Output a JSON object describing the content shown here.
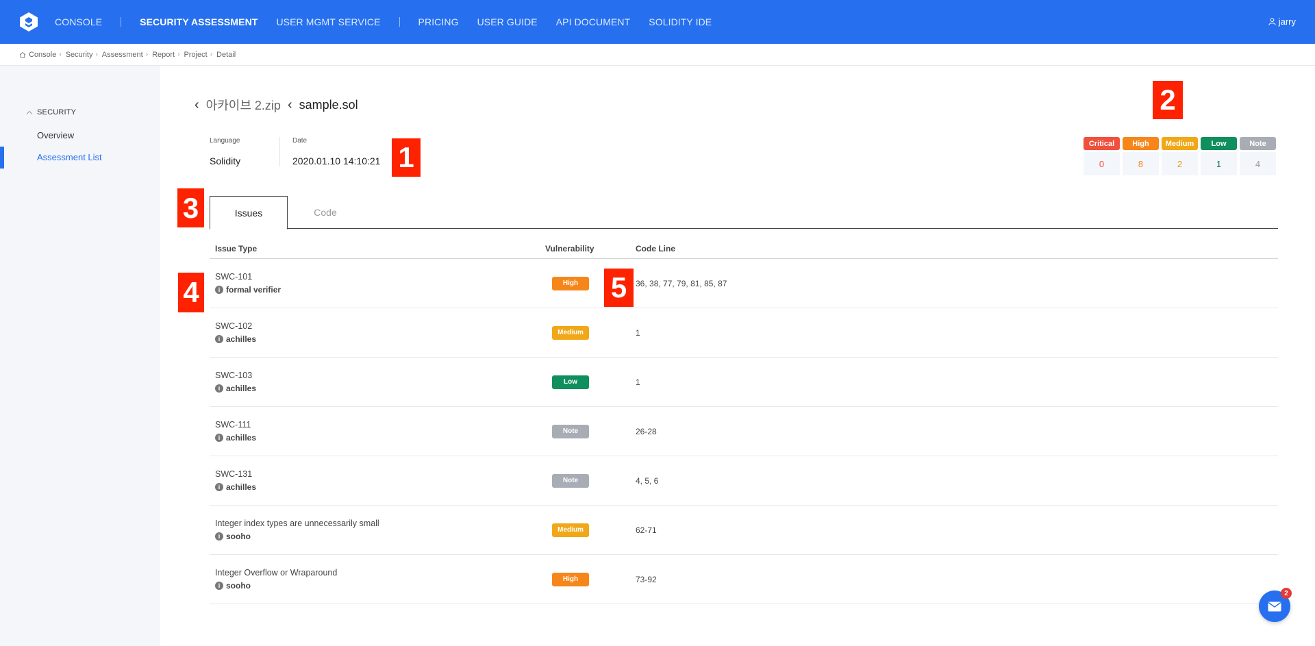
{
  "nav": {
    "items": [
      {
        "label": "CONSOLE",
        "active": false
      },
      {
        "label": "SECURITY ASSESSMENT",
        "active": true
      },
      {
        "label": "USER MGMT SERVICE",
        "active": false
      },
      {
        "label": "PRICING",
        "active": false
      },
      {
        "label": "USER GUIDE",
        "active": false
      },
      {
        "label": "API DOCUMENT",
        "active": false
      },
      {
        "label": "SOLIDITY IDE",
        "active": false
      }
    ],
    "user": "jarry"
  },
  "breadcrumb": [
    "Console",
    "Security",
    "Assessment",
    "Report",
    "Project",
    "Detail"
  ],
  "sidebar": {
    "section": "SECURITY",
    "items": [
      {
        "label": "Overview",
        "active": false
      },
      {
        "label": "Assessment List",
        "active": true
      }
    ]
  },
  "header": {
    "archive": "아카이브 2.zip",
    "file": "sample.sol"
  },
  "meta": {
    "language_label": "Language",
    "language": "Solidity",
    "date_label": "Date",
    "date": "2020.01.10 14:10:21"
  },
  "severity": [
    {
      "label": "Critical",
      "count": "0",
      "color": "#f0503c",
      "text": "#f0503c"
    },
    {
      "label": "High",
      "count": "8",
      "color": "#f7861a",
      "text": "#f7861a"
    },
    {
      "label": "Medium",
      "count": "2",
      "color": "#f0a818",
      "text": "#e69a10"
    },
    {
      "label": "Low",
      "count": "1",
      "color": "#0f8f5e",
      "text": "#0f6f4e"
    },
    {
      "label": "Note",
      "count": "4",
      "color": "#a8adb5",
      "text": "#999999"
    }
  ],
  "tabs": {
    "issues": "Issues",
    "code": "Code"
  },
  "table": {
    "headers": {
      "issue_type": "Issue Type",
      "vulnerability": "Vulnerability",
      "code_line": "Code Line"
    },
    "rows": [
      {
        "name": "SWC-101",
        "tool": "formal verifier",
        "vuln": "High",
        "lines": "36, 38, 77, 79, 81, 85, 87"
      },
      {
        "name": "SWC-102",
        "tool": "achilles",
        "vuln": "Medium",
        "lines": "1"
      },
      {
        "name": "SWC-103",
        "tool": "achilles",
        "vuln": "Low",
        "lines": "1"
      },
      {
        "name": "SWC-111",
        "tool": "achilles",
        "vuln": "Note",
        "lines": "26-28"
      },
      {
        "name": "SWC-131",
        "tool": "achilles",
        "vuln": "Note",
        "lines": "4, 5, 6"
      },
      {
        "name": "Integer index types are unnecessarily small",
        "tool": "sooho",
        "vuln": "Medium",
        "lines": "62-71"
      },
      {
        "name": "Integer Overflow or Wraparound",
        "tool": "sooho",
        "vuln": "High",
        "lines": "73-92"
      }
    ]
  },
  "markers": [
    "1",
    "2",
    "3",
    "4",
    "5"
  ],
  "chat": {
    "badge": "2"
  }
}
